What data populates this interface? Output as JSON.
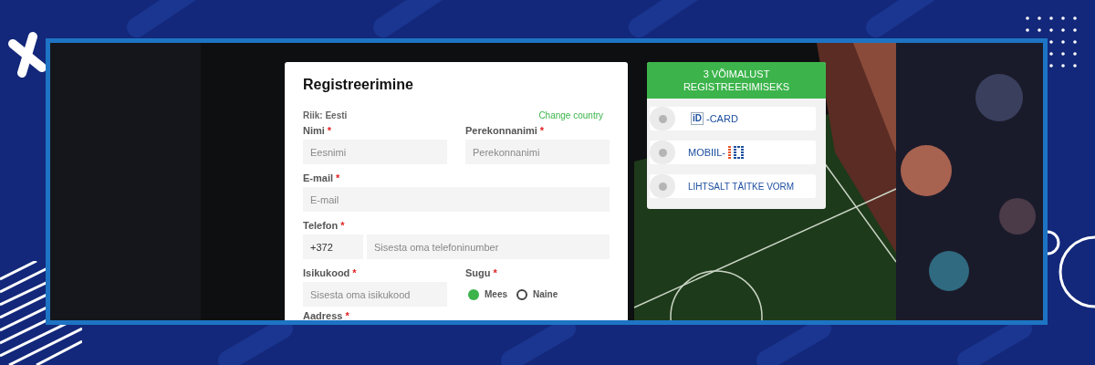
{
  "form": {
    "title": "Registreerimine",
    "country_label": "Riik: Eesti",
    "change_country": "Change country",
    "name_fields": [
      {
        "label": "Nimi",
        "mark": "*",
        "placeholder": "Eesnimi"
      },
      {
        "label": "Perekonnanimi",
        "mark": "*",
        "placeholder": "Perekonnanimi"
      }
    ],
    "email": {
      "label": "E-mail",
      "mark": "*",
      "placeholder": "E-mail"
    },
    "phone": {
      "label": "Telefon",
      "mark": "*",
      "prefix": "+372",
      "placeholder": "Sisesta oma telefoninumber"
    },
    "id_code": {
      "label": "Isikukood",
      "mark": "*",
      "placeholder": "Sisesta oma isikukood"
    },
    "gender": {
      "label": "Sugu",
      "mark": "*",
      "options": [
        {
          "label": "Mees",
          "selected": true
        },
        {
          "label": "Naine",
          "selected": false
        }
      ]
    },
    "address": {
      "label": "Aadress",
      "mark": "*"
    }
  },
  "options_panel": {
    "title": "3 VÕIMALUST REGISTREERIMISEKS",
    "options": [
      {
        "kind": "id-card",
        "badge": "iD",
        "label": "-CARD",
        "selected": false
      },
      {
        "kind": "mobiil-id",
        "label": "MOBIIL-",
        "selected": false
      },
      {
        "kind": "text",
        "label": "LIHTSALT TÄITKE VORM",
        "selected": false
      }
    ]
  }
}
